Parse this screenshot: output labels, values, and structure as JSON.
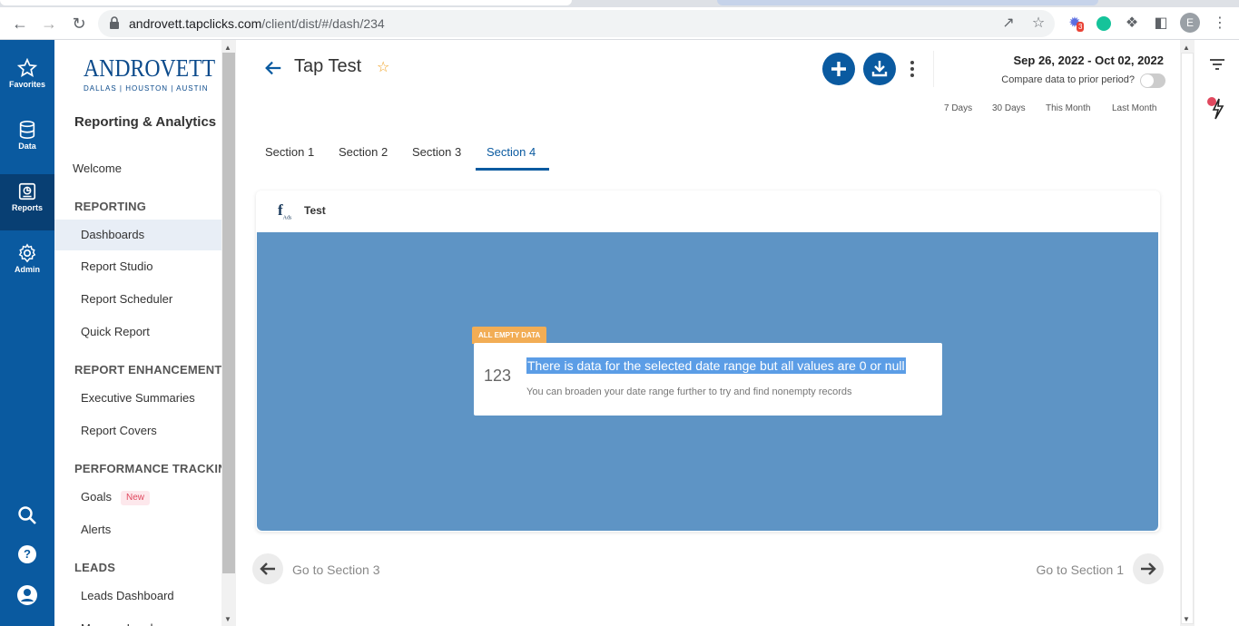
{
  "browser": {
    "url_host": "androvett.tapclicks.com",
    "url_path": "/client/dist/#/dash/234",
    "ext_badge": "3",
    "profile_initial": "E"
  },
  "rail": {
    "items": [
      {
        "label": "Favorites",
        "icon": "star-icon"
      },
      {
        "label": "Data",
        "icon": "database-icon"
      },
      {
        "label": "Reports",
        "icon": "reports-icon"
      },
      {
        "label": "Admin",
        "icon": "gear-icon"
      }
    ],
    "bottom": [
      "search-icon",
      "help-icon",
      "user-icon"
    ],
    "help_glyph": "?"
  },
  "sidebar": {
    "logo_name": "ANDROVETT",
    "logo_cities": "DALLAS  |  HOUSTON  |  AUSTIN",
    "app_title": "Reporting & Analytics",
    "welcome": "Welcome",
    "reporting_head": "REPORTING",
    "dashboards": "Dashboards",
    "report_studio": "Report Studio",
    "report_scheduler": "Report Scheduler",
    "quick_report": "Quick Report",
    "enh_head": "REPORT ENHANCEMENTS",
    "exec_summaries": "Executive Summaries",
    "report_covers": "Report Covers",
    "perf_head": "PERFORMANCE TRACKING",
    "goals": "Goals",
    "goals_badge": "New",
    "alerts": "Alerts",
    "leads_head": "LEADS",
    "leads_dashboard": "Leads Dashboard",
    "manage_leads": "Manage Leads"
  },
  "header": {
    "title": "Tap Test",
    "date_range": "Sep 26, 2022 - Oct 02, 2022",
    "compare_label": "Compare data to prior period?",
    "compare_on": false,
    "quick_ranges": [
      "7 Days",
      "30 Days",
      "This Month",
      "Last Month"
    ]
  },
  "tabs": [
    {
      "label": "Section 1"
    },
    {
      "label": "Section 2"
    },
    {
      "label": "Section 3"
    },
    {
      "label": "Section 4",
      "active": true
    }
  ],
  "widget": {
    "icon_letter": "f",
    "icon_sub": "Ads",
    "title": "Test",
    "body_color": "#5e94c5",
    "tag": "ALL EMPTY DATA",
    "number": "123",
    "message": "There is data for the selected date range but all values are 0 or null",
    "hint": "You can broaden your date range further to try and find nonempty records"
  },
  "footer_nav": {
    "prev_label": "Go to Section 3",
    "next_label": "Go to Section 1"
  },
  "colors": {
    "brand": "#0a5aa0",
    "tag": "#f2ad55",
    "star": "#f0a020"
  }
}
